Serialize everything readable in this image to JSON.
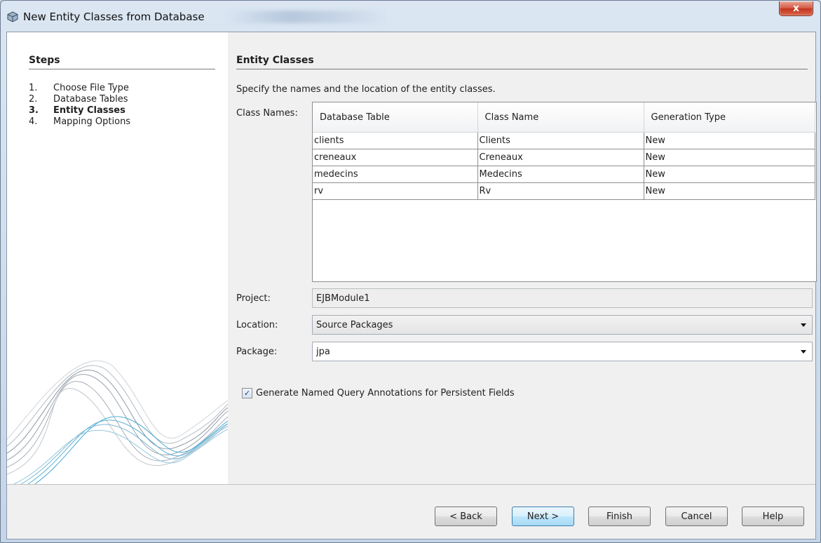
{
  "window": {
    "title": "New Entity Classes from Database",
    "close_symbol": "x"
  },
  "steps": {
    "title": "Steps",
    "items": [
      {
        "num": "1.",
        "label": "Choose File Type"
      },
      {
        "num": "2.",
        "label": "Database Tables"
      },
      {
        "num": "3.",
        "label": "Entity Classes",
        "current": true
      },
      {
        "num": "4.",
        "label": "Mapping Options"
      }
    ]
  },
  "main": {
    "title": "Entity Classes",
    "description": "Specify the names and the location of the entity classes.",
    "class_names_label": "Class Names:",
    "table": {
      "columns": [
        "Database Table",
        "Class Name",
        "Generation Type"
      ],
      "rows": [
        [
          "clients",
          "Clients",
          "New"
        ],
        [
          "creneaux",
          "Creneaux",
          "New"
        ],
        [
          "medecins",
          "Medecins",
          "New"
        ],
        [
          "rv",
          "Rv",
          "New"
        ]
      ]
    },
    "project_label": "Project:",
    "project_value": "EJBModule1",
    "location_label": "Location:",
    "location_value": "Source Packages",
    "package_label": "Package:",
    "package_value": "jpa",
    "checkbox_label": "Generate Named Query Annotations for Persistent Fields",
    "checkbox_checked": true,
    "checkbox_mark": "✓"
  },
  "footer": {
    "back": "< Back",
    "next": "Next >",
    "finish": "Finish",
    "cancel": "Cancel",
    "help": "Help"
  }
}
